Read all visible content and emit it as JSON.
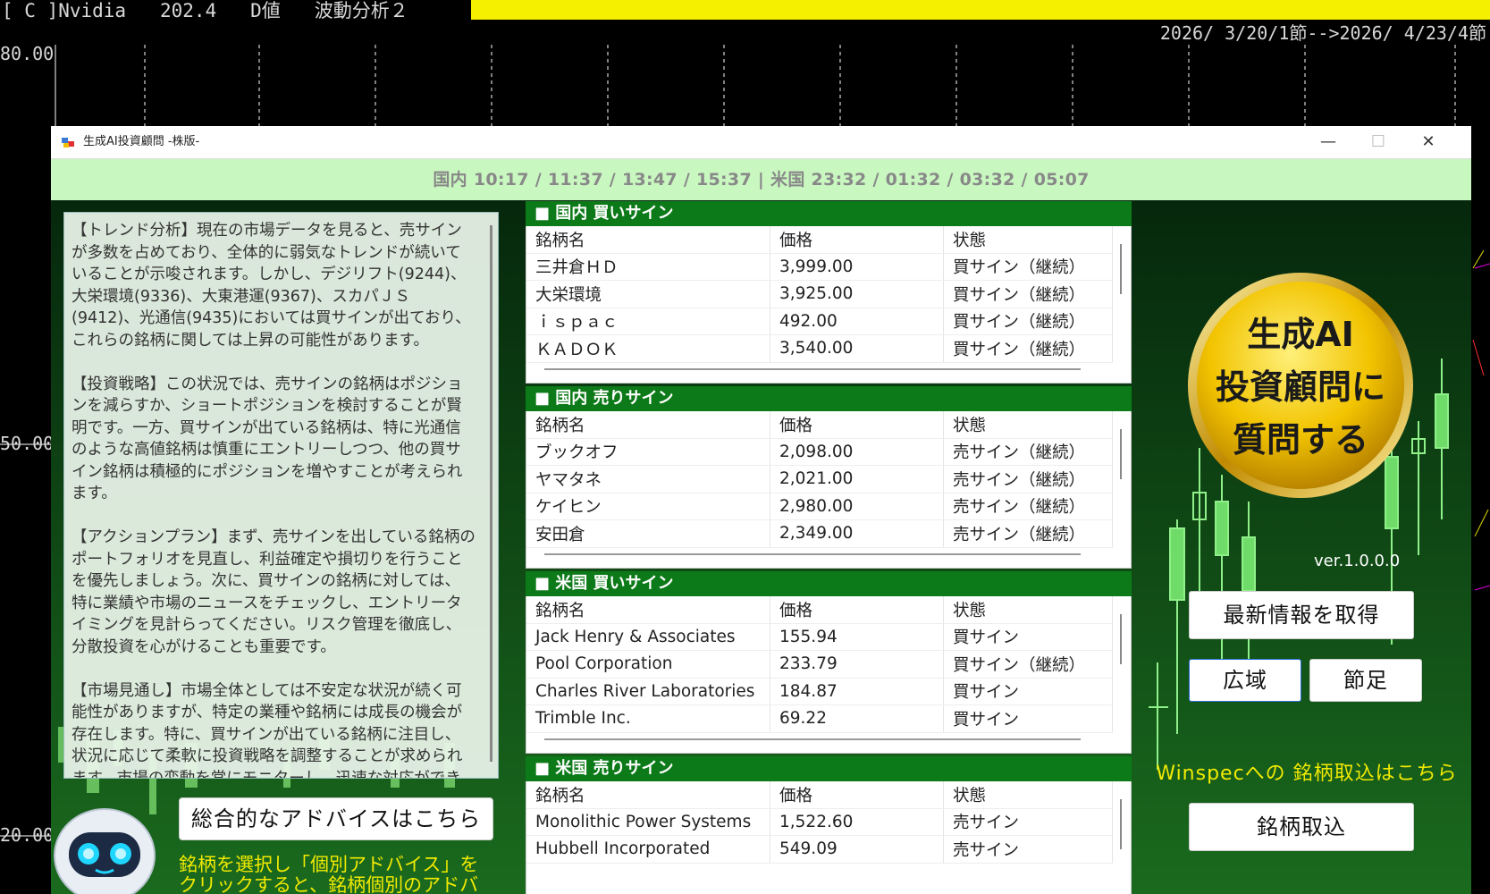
{
  "background_chart": {
    "title": "[ C ]Nvidia   202.4   D値   波動分析２",
    "range": "2026/ 3/20/1節-->2026/ 4/23/4節",
    "y_labels": [
      "80.00",
      "50.00",
      "20.00"
    ],
    "colors": {
      "highlight": "#f5f000",
      "grid": "#ffffff"
    }
  },
  "window": {
    "title": "生成AI投資顧問 -株版-",
    "controls": {
      "minimize": "—",
      "maximize": "☐",
      "close": "✕"
    }
  },
  "timebar": "国内 10:17 / 11:37 / 13:47 / 15:37  |  米国 23:32 / 01:32 / 03:32 / 05:07",
  "advice": {
    "text": "【トレンド分析】現在の市場データを見ると、売サインが多数を占めており、全体的に弱気なトレンドが続いていることが示唆されます。しかし、デジリフト(9244)、大栄環境(9336)、大東港運(9367)、スカパＪＳ(9412)、光通信(9435)においては買サインが出ており、これらの銘柄に関しては上昇の可能性があります。\n\n【投資戦略】この状況では、売サインの銘柄はポジションを減らすか、ショートポジションを検討することが賢明です。一方、買サインが出ている銘柄は、特に光通信のような高値銘柄は慎重にエントリーしつつ、他の買サイン銘柄は積極的にポジションを増やすことが考えられます。\n\n【アクションプラン】まず、売サインを出している銘柄のポートフォリオを見直し、利益確定や損切りを行うことを優先しましょう。次に、買サインの銘柄に対しては、特に業績や市場のニュースをチェックし、エントリータイミングを見計らってください。リスク管理を徹底し、分散投資を心がけることも重要です。\n\n【市場見通し】市場全体としては不安定な状況が続く可能性がありますが、特定の業種や銘柄には成長の機会が存在します。特に、買サインが出ている銘柄に注目し、状況に応じて柔軟に投資戦略を調整することが求められます。市場の変動を常にモニターし、迅速な対応ができる体制を整えておくことが重要です。",
    "general_button": "総合的なアドバイスはこちら",
    "hint": "銘柄を選択し「個別アドバイス」をクリックすると、銘柄個別のアドバイスが表"
  },
  "tables": [
    {
      "title": "■ 国内 買いサイン",
      "headers": [
        "銘柄名",
        "価格",
        "状態"
      ],
      "rows": [
        [
          "三井倉ＨＤ",
          "3,999.00",
          "買サイン（継続）"
        ],
        [
          "大栄環境",
          "3,925.00",
          "買サイン（継続）"
        ],
        [
          "ｉｓｐａｃ",
          "492.00",
          "買サイン（継続）"
        ],
        [
          "ＫＡＤＯＫ",
          "3,540.00",
          "買サイン（継続）"
        ]
      ]
    },
    {
      "title": "■ 国内 売りサイン",
      "headers": [
        "銘柄名",
        "価格",
        "状態"
      ],
      "rows": [
        [
          "ブックオフ",
          "2,098.00",
          "売サイン（継続）"
        ],
        [
          "ヤマタネ",
          "2,021.00",
          "売サイン（継続）"
        ],
        [
          "ケイヒン",
          "2,980.00",
          "売サイン（継続）"
        ],
        [
          "安田倉",
          "2,349.00",
          "売サイン（継続）"
        ]
      ]
    },
    {
      "title": "■ 米国 買いサイン",
      "headers": [
        "銘柄名",
        "価格",
        "状態"
      ],
      "rows": [
        [
          "Jack Henry & Associates",
          "155.94",
          "買サイン"
        ],
        [
          "Pool Corporation",
          "233.79",
          "買サイン（継続）"
        ],
        [
          "Charles River Laboratories",
          "184.87",
          "買サイン"
        ],
        [
          "Trimble Inc.",
          "69.22",
          "買サイン"
        ]
      ]
    },
    {
      "title": "■ 米国 売りサイン",
      "headers": [
        "銘柄名",
        "価格",
        "状態"
      ],
      "rows": [
        [
          "Monolithic Power Systems",
          "1,522.60",
          "売サイン"
        ],
        [
          "Hubbell Incorporated",
          "549.09",
          "売サイン"
        ]
      ]
    }
  ],
  "right_panel": {
    "badge_lines": [
      "生成AI",
      "投資顧問に",
      "質問する"
    ],
    "version": "ver.1.0.0.0",
    "refresh_button": "最新情報を取得",
    "wide_button": "広域",
    "node_button": "節足",
    "winspec_text": "Winspecへの 銘柄取込はこちら",
    "import_button": "銘柄取込"
  },
  "colors": {
    "window_bg": "#0d3a10",
    "timebar_bg": "#c9f7c0",
    "table_header": "#0d7a19",
    "hint_yellow": "#f2ea00",
    "badge_gold": "#e6b400"
  }
}
